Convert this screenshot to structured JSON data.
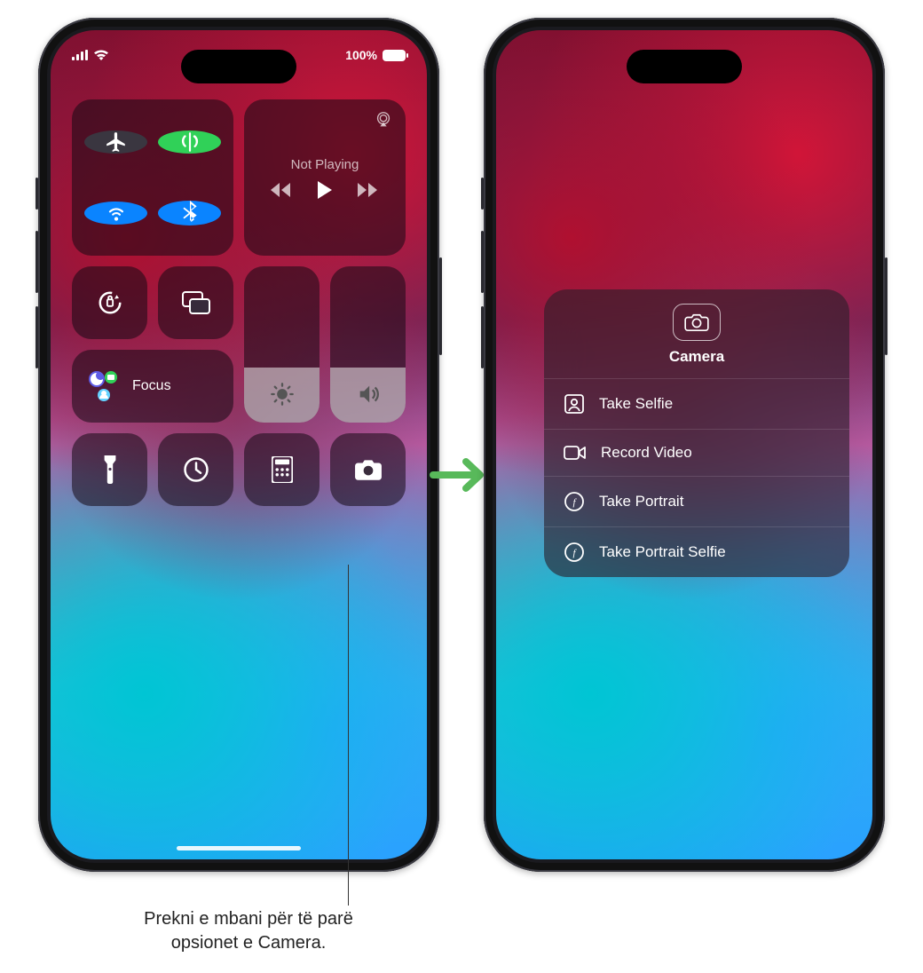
{
  "status": {
    "battery_pct": "100%"
  },
  "connectivity": {
    "airplane": "airplane-icon",
    "cellular": "antenna-icon",
    "wifi": "wifi-icon",
    "bluetooth": "bluetooth-icon"
  },
  "media": {
    "title": "Not Playing"
  },
  "focus": {
    "label": "Focus"
  },
  "bottom_row": {
    "flashlight": "flashlight-icon",
    "timer": "timer-icon",
    "calculator": "calculator-icon",
    "camera": "camera-icon"
  },
  "camera_menu": {
    "title": "Camera",
    "items": [
      {
        "icon": "selfie-icon",
        "label": "Take Selfie"
      },
      {
        "icon": "video-icon",
        "label": "Record Video"
      },
      {
        "icon": "portrait-icon",
        "label": "Take Portrait"
      },
      {
        "icon": "portrait-selfie-icon",
        "label": "Take Portrait Selfie"
      }
    ]
  },
  "callout": {
    "line1": "Prekni e mbani për të parë",
    "line2": "opsionet e Camera."
  }
}
